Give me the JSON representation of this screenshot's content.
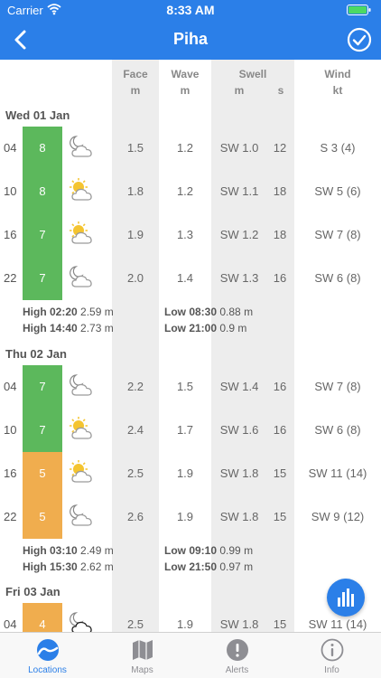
{
  "status_bar": {
    "carrier": "Carrier",
    "time": "8:33 AM"
  },
  "nav": {
    "title": "Piha"
  },
  "columns": {
    "face": {
      "label": "Face",
      "unit": "m"
    },
    "wave": {
      "label": "Wave",
      "unit": "m"
    },
    "swell": {
      "label": "Swell",
      "unit_height": "m",
      "unit_period": "s"
    },
    "wind": {
      "label": "Wind",
      "unit": "kt"
    }
  },
  "rating_colors": {
    "good": "#5CB85C",
    "fair": "#F0AD4E"
  },
  "days": [
    {
      "label": "Wed 01 Jan",
      "rows": [
        {
          "hour": "04",
          "rating": "8",
          "icon": "moon-cloud",
          "face": "1.5",
          "wave": "1.2",
          "swell": "SW 1.0",
          "period": "12",
          "wind": "S 3 (4)"
        },
        {
          "hour": "10",
          "rating": "8",
          "icon": "sun-cloud",
          "face": "1.8",
          "wave": "1.2",
          "swell": "SW 1.1",
          "period": "18",
          "wind": "SW 5 (6)"
        },
        {
          "hour": "16",
          "rating": "7",
          "icon": "sun-cloud",
          "face": "1.9",
          "wave": "1.3",
          "swell": "SW 1.2",
          "period": "18",
          "wind": "SW 7 (8)"
        },
        {
          "hour": "22",
          "rating": "7",
          "icon": "moon-cloud",
          "face": "2.0",
          "wave": "1.4",
          "swell": "SW 1.3",
          "period": "16",
          "wind": "SW 6 (8)"
        }
      ],
      "tides": {
        "high1_time": "High 02:20",
        "high1_height": "2.59 m",
        "high2_time": "High 14:40",
        "high2_height": "2.73 m",
        "low1_time": "Low 08:30",
        "low1_height": "0.88 m",
        "low2_time": "Low 21:00",
        "low2_height": "0.9 m"
      }
    },
    {
      "label": "Thu 02 Jan",
      "rows": [
        {
          "hour": "04",
          "rating": "7",
          "icon": "moon-cloud",
          "face": "2.2",
          "wave": "1.5",
          "swell": "SW 1.4",
          "period": "16",
          "wind": "SW 7 (8)"
        },
        {
          "hour": "10",
          "rating": "7",
          "icon": "sun-cloud",
          "face": "2.4",
          "wave": "1.7",
          "swell": "SW 1.6",
          "period": "16",
          "wind": "SW 6 (8)"
        },
        {
          "hour": "16",
          "rating": "5",
          "icon": "sun-cloud",
          "face": "2.5",
          "wave": "1.9",
          "swell": "SW 1.8",
          "period": "15",
          "wind": "SW 11 (14)"
        },
        {
          "hour": "22",
          "rating": "5",
          "icon": "moon-cloud",
          "face": "2.6",
          "wave": "1.9",
          "swell": "SW 1.8",
          "period": "15",
          "wind": "SW 9 (12)"
        }
      ],
      "tides": {
        "high1_time": "High 03:10",
        "high1_height": "2.49 m",
        "high2_time": "High 15:30",
        "high2_height": "2.62 m",
        "low1_time": "Low 09:10",
        "low1_height": "0.99 m",
        "low2_time": "Low 21:50",
        "low2_height": "0.97 m"
      }
    },
    {
      "label": "Fri 03 Jan",
      "rows": [
        {
          "hour": "04",
          "rating": "4",
          "icon": "moon-dark-cloud",
          "face": "2.5",
          "wave": "1.9",
          "swell": "SW 1.8",
          "period": "15",
          "wind": "SW 11 (14)"
        }
      ]
    }
  ],
  "tabs": [
    {
      "label": "Locations",
      "icon": "wave-icon",
      "active": true
    },
    {
      "label": "Maps",
      "icon": "map-icon",
      "active": false
    },
    {
      "label": "Alerts",
      "icon": "alert-icon",
      "active": false
    },
    {
      "label": "Info",
      "icon": "info-icon",
      "active": false
    }
  ],
  "accent": "#2B7FE8"
}
